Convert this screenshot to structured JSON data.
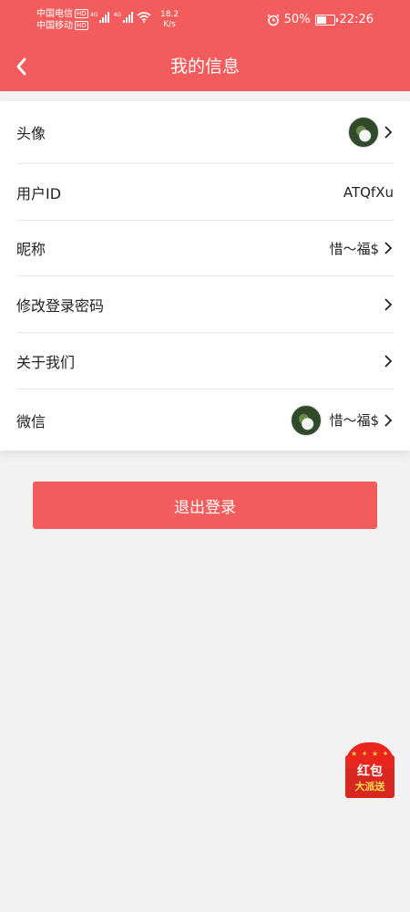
{
  "status_bar": {
    "carrier1": "中国电信",
    "carrier2": "中国移动",
    "hd": "HD",
    "net_tag": "4G",
    "speed_value": "18.2",
    "speed_unit": "K/s",
    "battery": "50%",
    "time": "22:26"
  },
  "header": {
    "title": "我的信息",
    "back_icon": "chevron-left-icon",
    "background": "#f25c5c"
  },
  "rows": [
    {
      "label": "头像",
      "value": ""
    },
    {
      "label": "用户ID",
      "value": "ATQfXu"
    },
    {
      "label": "昵称",
      "value": "惜～福$"
    },
    {
      "label": "修改登录密码",
      "value": ""
    },
    {
      "label": "关于我们",
      "value": ""
    },
    {
      "label": "微信",
      "value": "惜～福$"
    }
  ],
  "logout": {
    "label": "退出登录"
  },
  "red_packet": {
    "line1": "红包",
    "line2": "大派送",
    "decor": "★ ✦ ★ ✦"
  },
  "colors": {
    "accent": "#f25c5c",
    "background": "#f2f2f2"
  }
}
